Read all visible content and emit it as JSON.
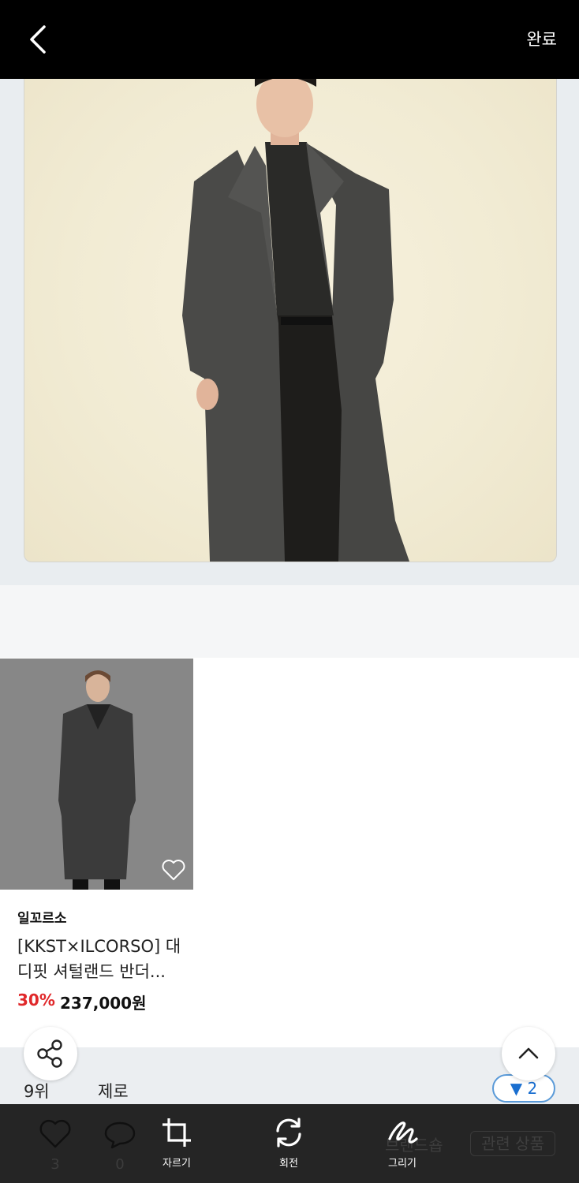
{
  "header": {
    "done_label": "완료"
  },
  "product": {
    "brand": "일꼬르소",
    "title_line1": "[KKST×ILCORSO] 대",
    "title_line2": "디핏 셔털랜드 반더...",
    "discount": "30%",
    "price": "237,000원"
  },
  "ranking": {
    "rank": "9위",
    "name": "제로",
    "change": "▼ 2"
  },
  "footer": {
    "like_count": "3",
    "comment_count": "0",
    "shop_label": "브랜드숍",
    "related_label": "관련 상품"
  },
  "tools": {
    "crop": "자르기",
    "rotate": "회전",
    "draw": "그리기"
  },
  "colors": {
    "discount": "#e0282a",
    "rank_badge": "#1a6fd0",
    "toolbar_bg": "#252525"
  }
}
